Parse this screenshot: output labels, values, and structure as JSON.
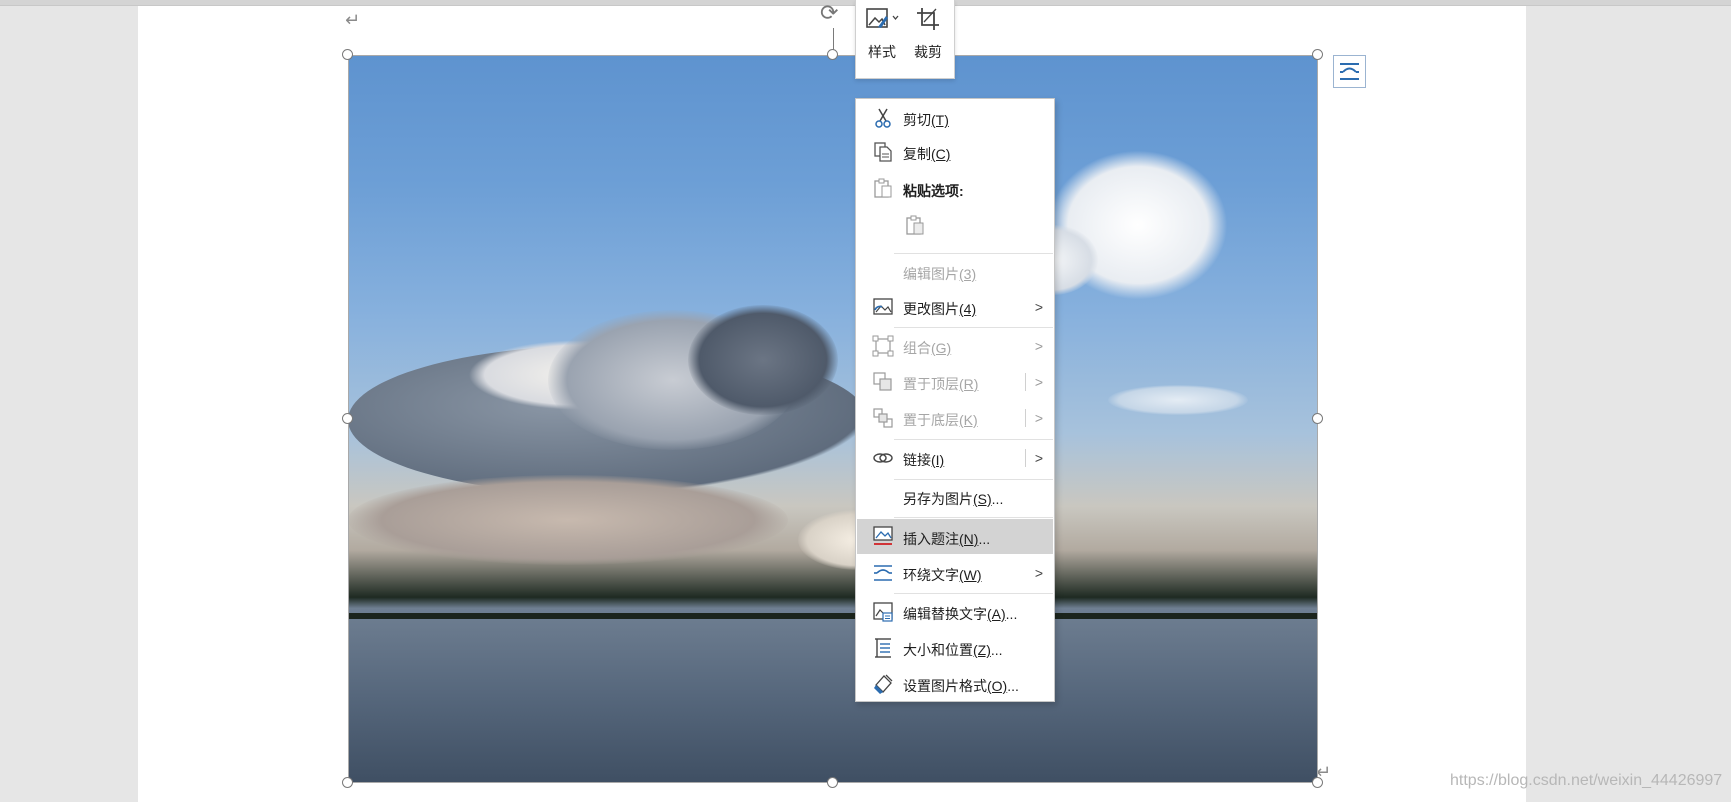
{
  "paragraph_marks": [
    "↵",
    "↵"
  ],
  "mini_toolbar": [
    {
      "label": "样式",
      "icon": "picture-style-icon"
    },
    {
      "label": "裁剪",
      "icon": "crop-icon"
    }
  ],
  "context_menu": {
    "cut": {
      "label": "剪切",
      "key": "(T)"
    },
    "copy": {
      "label": "复制",
      "key": "(C)"
    },
    "paste_options": {
      "label": "粘贴选项:"
    },
    "edit_picture": {
      "label": "编辑图片",
      "key": "(3)"
    },
    "change_picture": {
      "label": "更改图片",
      "key": "(4)"
    },
    "group": {
      "label": "组合",
      "key": "(G)"
    },
    "bring_to_front": {
      "label": "置于顶层",
      "key": "(R)"
    },
    "send_to_back": {
      "label": "置于底层",
      "key": "(K)"
    },
    "link": {
      "label": "链接",
      "key": "(I)"
    },
    "save_as_picture": {
      "label": "另存为图片",
      "key": "(S)",
      "suffix": "..."
    },
    "insert_caption": {
      "label": "插入题注",
      "key": "(N)",
      "suffix": "..."
    },
    "wrap_text": {
      "label": "环绕文字",
      "key": "(W)"
    },
    "edit_alt_text": {
      "label": "编辑替换文字",
      "key": "(A)",
      "suffix": "..."
    },
    "size_position": {
      "label": "大小和位置",
      "key": "(Z)",
      "suffix": "..."
    },
    "format_picture": {
      "label": "设置图片格式",
      "key": "(O)",
      "suffix": "..."
    }
  },
  "submenu_arrow": ">",
  "watermark": "https://blog.csdn.net/weixin_44426997",
  "colors": {
    "highlight": "#d3d3d3",
    "disabled_text": "#a6a6a6",
    "icon_blue": "#2b6cb0"
  }
}
